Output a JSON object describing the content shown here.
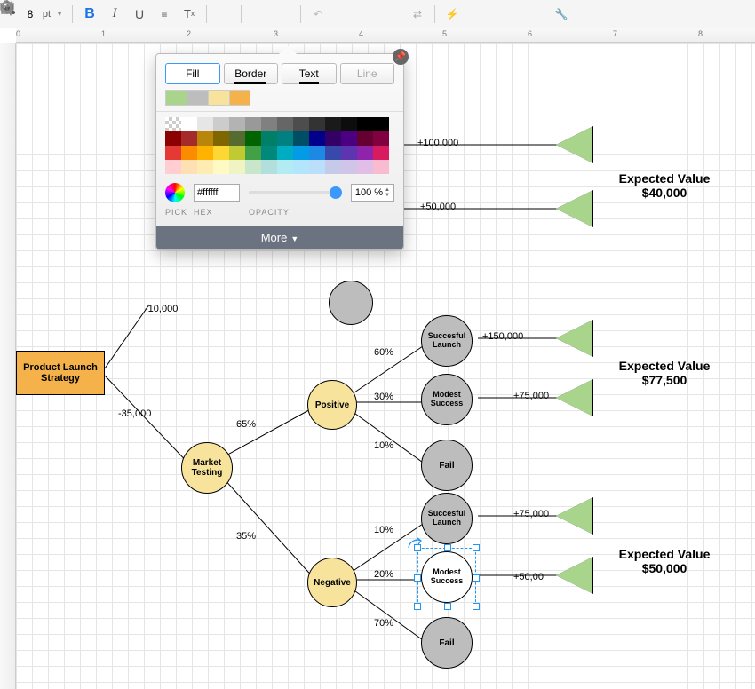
{
  "toolbar": {
    "font_size": "8",
    "font_unit": "pt",
    "bold": "B",
    "italic": "I",
    "underline": "U"
  },
  "popup": {
    "tabs": {
      "fill": "Fill",
      "border": "Border",
      "text": "Text",
      "line": "Line"
    },
    "recent_colors": [
      "#a8d48b",
      "#bdbdbd",
      "#f7e39c",
      "#f5b24a"
    ],
    "hex_value": "#ffffff",
    "opacity_value": "100 %",
    "labels": {
      "pick": "PICK",
      "hex": "HEX",
      "opacity": "OPACITY"
    },
    "more": "More"
  },
  "diagram": {
    "root": "Product Launch Strategy",
    "edges": {
      "root_top": "-10,000",
      "root_bottom": "-35,000",
      "pos_prob": "65%",
      "neg_prob": "35%",
      "pos_60": "60%",
      "pos_30": "30%",
      "pos_10": "10%",
      "neg_10": "10%",
      "neg_20": "20%",
      "neg_70": "70%",
      "val_100k": "+100,000",
      "val_50k": "+50,000",
      "val_150k": "+150,000",
      "val_75k_a": "+75,000",
      "val_75k_b": "+75,000",
      "val_50k_b": "+50,00"
    },
    "nodes": {
      "market_testing": "Market Testing",
      "positive": "Positive",
      "negative": "Negative",
      "succesful_launch": "Succesful Launch",
      "modest_success": "Modest Success",
      "fail": "Fail"
    },
    "ev": {
      "label": "Expected Value",
      "ev1": "$40,000",
      "ev2": "$77,500",
      "ev3": "$50,000"
    }
  },
  "ruler_marks": [
    "0",
    "1",
    "2",
    "3",
    "4",
    "5",
    "6",
    "7",
    "8"
  ]
}
